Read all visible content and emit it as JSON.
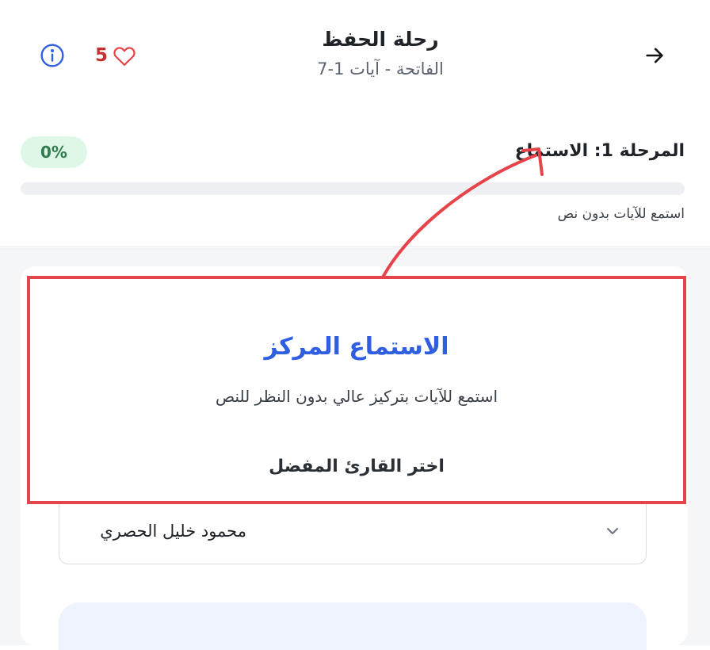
{
  "header": {
    "title": "رحلة الحفظ",
    "subtitle": "الفاتحة - آيات 1-7",
    "hearts_count": "5",
    "back_icon": "arrow-right-icon",
    "info_icon": "info-icon",
    "heart_icon": "heart-outline-icon"
  },
  "stage": {
    "label": "المرحلة 1: الاستماع",
    "percent_text": "0%",
    "progress": 0,
    "description": "استمع للآيات بدون نص"
  },
  "mode": {
    "title": "الاستماع المركز",
    "description": "استمع للآيات بتركيز عالي بدون النظر للنص",
    "reciter_label": "اختر القارئ المفضل"
  },
  "reciter_select": {
    "selected": "محمود خليل الحصري",
    "chevron_icon": "chevron-down-icon"
  },
  "colors": {
    "accent_blue": "#2f5fe0",
    "heart_red": "#c53030",
    "annotation_red": "#e5454a",
    "badge_green_bg": "#def7e6",
    "badge_green_text": "#2f7d4e"
  }
}
